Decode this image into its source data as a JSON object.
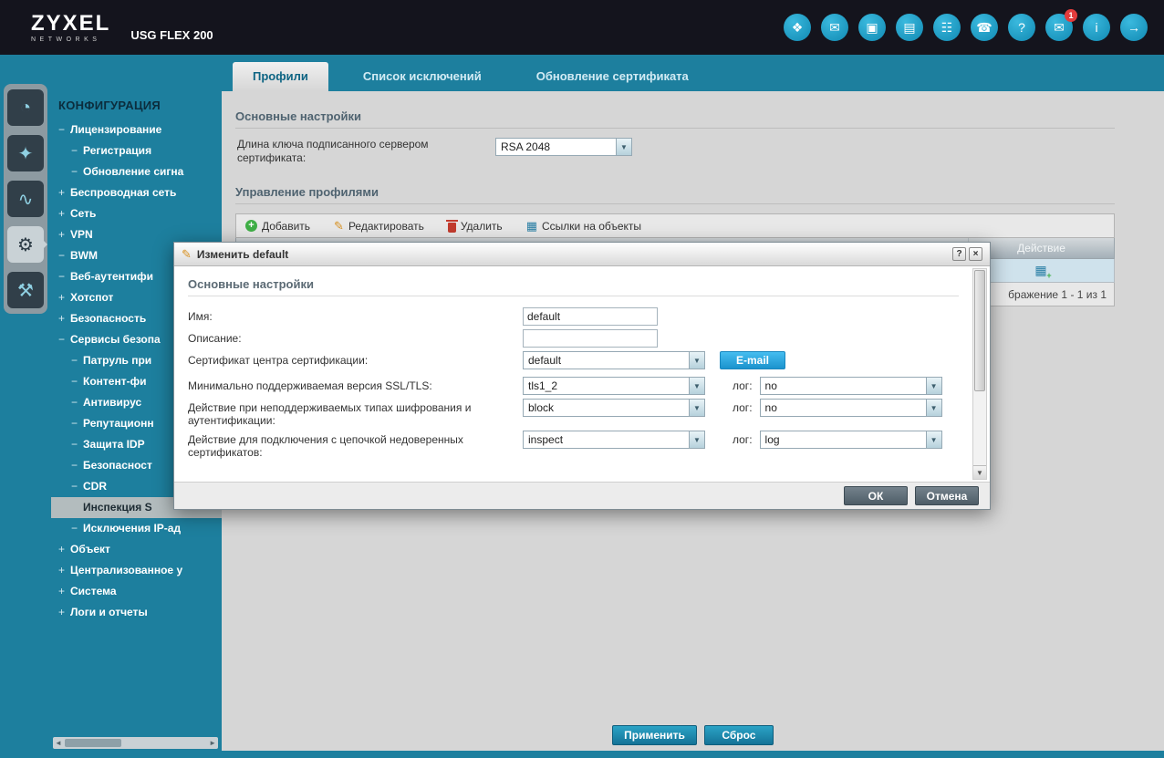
{
  "header": {
    "logo": "ZYXEL",
    "logo_sub": "NETWORKS",
    "model": "USG FLEX 200",
    "icons": [
      {
        "name": "secureporter-icon",
        "glyph": "❖"
      },
      {
        "name": "web-console-icon",
        "glyph": "✉"
      },
      {
        "name": "cli-icon",
        "glyph": "▣"
      },
      {
        "name": "reference-guide-icon",
        "glyph": "▤"
      },
      {
        "name": "site-map-icon",
        "glyph": "☷"
      },
      {
        "name": "console-icon",
        "glyph": "☎"
      },
      {
        "name": "help-icon",
        "glyph": "?"
      },
      {
        "name": "forum-icon",
        "glyph": "✉",
        "badge": "1"
      },
      {
        "name": "about-icon",
        "glyph": "i"
      },
      {
        "name": "logout-icon",
        "glyph": "→"
      }
    ]
  },
  "tabs": [
    {
      "label": "Профили"
    },
    {
      "label": "Список исключений"
    },
    {
      "label": "Обновление сертификата"
    }
  ],
  "sidebar": {
    "section": "КОНФИГУРАЦИЯ",
    "strip": [
      {
        "name": "dashboard-icon",
        "glyph": "◔"
      },
      {
        "name": "wizard-icon",
        "glyph": "✦"
      },
      {
        "name": "monitor-icon",
        "glyph": "∿"
      },
      {
        "name": "configuration-icon",
        "glyph": "⚙",
        "active": true
      },
      {
        "name": "maintenance-icon",
        "glyph": "⚒"
      }
    ],
    "items": [
      {
        "prefix": "−",
        "label": "Лицензирование",
        "level": 1
      },
      {
        "prefix": "−",
        "label": "Регистрация",
        "level": 2
      },
      {
        "prefix": "−",
        "label": "Обновление сигна",
        "level": 2
      },
      {
        "prefix": "+",
        "label": "Беспроводная сеть",
        "level": 1
      },
      {
        "prefix": "+",
        "label": "Сеть",
        "level": 1
      },
      {
        "prefix": "+",
        "label": "VPN",
        "level": 1
      },
      {
        "prefix": "−",
        "label": "BWM",
        "level": 1
      },
      {
        "prefix": "−",
        "label": "Веб-аутентифи",
        "level": 1
      },
      {
        "prefix": "+",
        "label": "Хотспот",
        "level": 1
      },
      {
        "prefix": "+",
        "label": "Безопасность",
        "level": 1
      },
      {
        "prefix": "−",
        "label": "Сервисы безопа",
        "level": 1
      },
      {
        "prefix": "−",
        "label": "Патруль при",
        "level": 2
      },
      {
        "prefix": "−",
        "label": "Контент-фи",
        "level": 2
      },
      {
        "prefix": "−",
        "label": "Антивирус",
        "level": 2
      },
      {
        "prefix": "−",
        "label": "Репутационн",
        "level": 2
      },
      {
        "prefix": "−",
        "label": "Защита IDP",
        "level": 2
      },
      {
        "prefix": "−",
        "label": "Безопасност",
        "level": 2
      },
      {
        "prefix": "−",
        "label": "CDR",
        "level": 2
      },
      {
        "prefix": "",
        "label": "Инспекция S",
        "level": 2,
        "selected": true
      },
      {
        "prefix": "−",
        "label": "Исключения IP-ад",
        "level": 2
      },
      {
        "prefix": "+",
        "label": "Объект",
        "level": 1
      },
      {
        "prefix": "+",
        "label": "Централизованное у",
        "level": 1
      },
      {
        "prefix": "+",
        "label": "Система",
        "level": 1
      },
      {
        "prefix": "+",
        "label": "Логи и отчеты",
        "level": 1
      }
    ]
  },
  "main": {
    "section1_title": "Основные настройки",
    "key_length_label": "Длина ключа подписанного сервером сертификата:",
    "key_length_value": "RSA 2048",
    "section2_title": "Управление профилями",
    "toolbar": [
      {
        "label": "Добавить"
      },
      {
        "label": "Редактировать"
      },
      {
        "label": "Удалить"
      },
      {
        "label": "Ссылки на объекты"
      }
    ],
    "table": {
      "action_header": "Действие",
      "pagination": "бражение 1 - 1 из 1"
    },
    "apply_button": "Применить",
    "reset_button": "Сброс"
  },
  "dialog": {
    "title": "Изменить default",
    "help_glyph": "?",
    "close_glyph": "×",
    "section_title": "Основные настройки",
    "rows": [
      {
        "label": "Имя:",
        "value": "default"
      },
      {
        "label": "Описание:",
        "value": ""
      },
      {
        "label": "Сертификат центра сертификации:",
        "value": "default",
        "button": "E-mail"
      },
      {
        "label": "Минимально поддерживаемая версия SSL/TLS:",
        "value": "tls1_2",
        "log_label": "лог:",
        "log_value": "no"
      },
      {
        "label": "Действие при неподдерживаемых типах шифрования и аутентификации:",
        "value": "block",
        "log_label": "лог:",
        "log_value": "no"
      },
      {
        "label": "Действие для подключения с цепочкой недоверенных сертификатов:",
        "value": "inspect",
        "log_label": "лог:",
        "log_value": "log"
      }
    ],
    "ok_button": "ОК",
    "cancel_button": "Отмена"
  },
  "icons": {
    "dropdown_arrow": "▼",
    "add": "+",
    "edit": "✎",
    "references": "▦",
    "row_action": "▦",
    "dialog_edit": "✎",
    "scroll_left": "◄",
    "scroll_right": "►",
    "scroll_down": "▼"
  }
}
